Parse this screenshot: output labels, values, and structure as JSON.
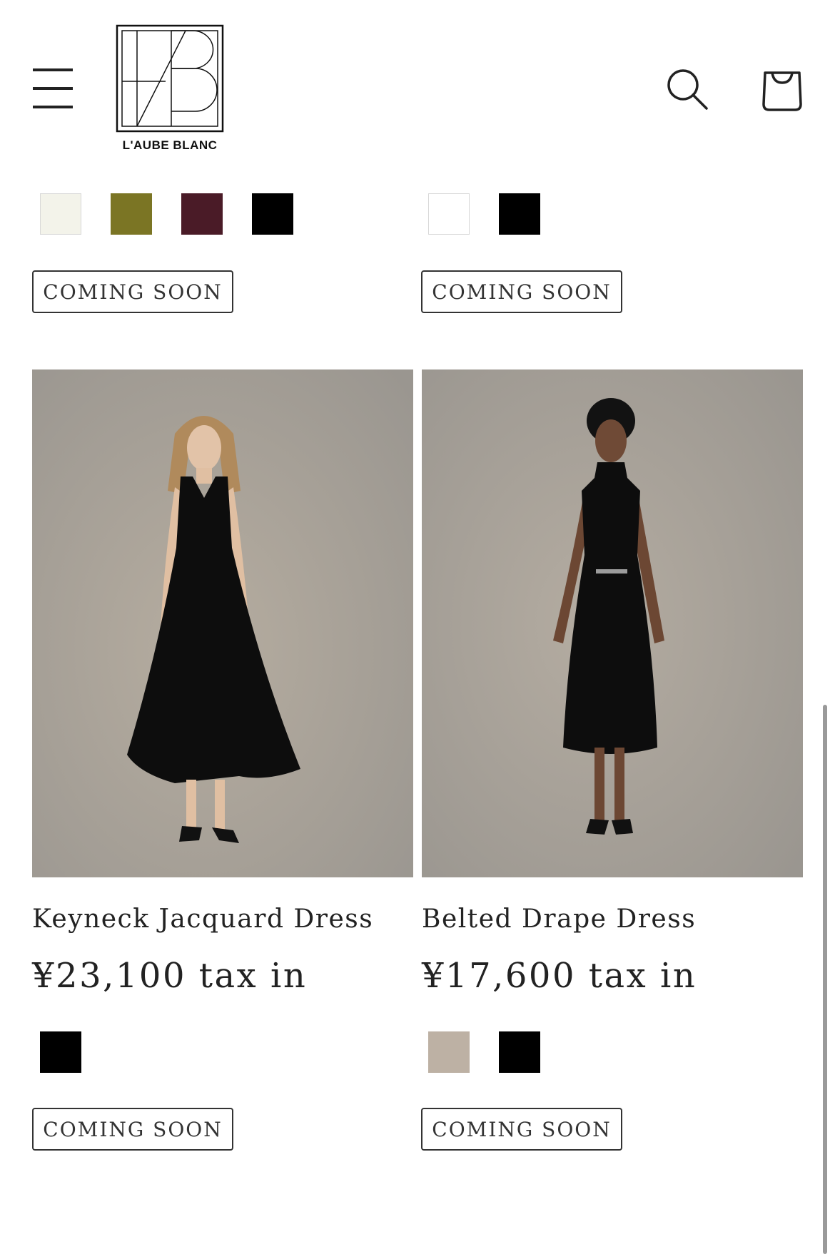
{
  "brand": {
    "name": "L'AUBE BLANC"
  },
  "header": {
    "menu_icon": "hamburger-menu-icon",
    "search_icon": "search-icon",
    "cart_icon": "shopping-bag-icon"
  },
  "previous_row": {
    "left": {
      "swatches": [
        "#f3f3ea",
        "#7b7524",
        "#4a1b27",
        "#000000"
      ],
      "button_label": "COMING SOON"
    },
    "right": {
      "swatches": [
        "#ffffff",
        "#000000"
      ],
      "button_label": "COMING SOON"
    }
  },
  "products": [
    {
      "title": "Keyneck Jacquard Dress",
      "price": "¥23,100 tax in",
      "swatches": [
        "#000000"
      ],
      "button_label": "COMING SOON"
    },
    {
      "title": "Belted Drape Dress",
      "price": "¥17,600 tax in",
      "swatches": [
        "#bdb1a4",
        "#000000"
      ],
      "button_label": "COMING SOON"
    }
  ]
}
